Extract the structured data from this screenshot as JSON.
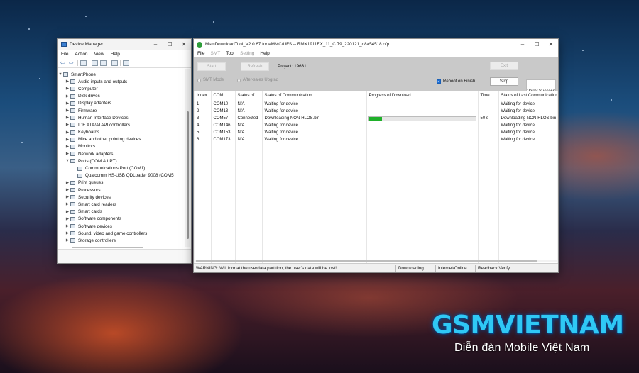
{
  "device_manager": {
    "title": "Device Manager",
    "menu": [
      "File",
      "Action",
      "View",
      "Help"
    ],
    "root": "SmartPhone",
    "categories": [
      {
        "label": "Audio inputs and outputs",
        "icon": "speaker-icon"
      },
      {
        "label": "Computer",
        "icon": "computer-icon"
      },
      {
        "label": "Disk drives",
        "icon": "disk-icon"
      },
      {
        "label": "Display adapters",
        "icon": "monitor-icon"
      },
      {
        "label": "Firmware",
        "icon": "chip-icon"
      },
      {
        "label": "Human Interface Devices",
        "icon": "hid-icon"
      },
      {
        "label": "IDE ATA/ATAPI controllers",
        "icon": "ide-icon"
      },
      {
        "label": "Keyboards",
        "icon": "keyboard-icon"
      },
      {
        "label": "Mice and other pointing devices",
        "icon": "mouse-icon"
      },
      {
        "label": "Monitors",
        "icon": "monitor-icon"
      },
      {
        "label": "Network adapters",
        "icon": "network-icon"
      },
      {
        "label": "Ports (COM & LPT)",
        "icon": "port-icon",
        "expanded": true,
        "children": [
          "Communications Port (COM1)",
          "Qualcomm HS-USB QDLoader 9008 (COM5"
        ]
      },
      {
        "label": "Print queues",
        "icon": "printer-icon"
      },
      {
        "label": "Processors",
        "icon": "cpu-icon"
      },
      {
        "label": "Security devices",
        "icon": "security-icon"
      },
      {
        "label": "Smart card readers",
        "icon": "card-reader-icon"
      },
      {
        "label": "Smart cards",
        "icon": "smart-card-icon"
      },
      {
        "label": "Software components",
        "icon": "component-icon"
      },
      {
        "label": "Software devices",
        "icon": "software-icon"
      },
      {
        "label": "Sound, video and game controllers",
        "icon": "sound-icon"
      },
      {
        "label": "Storage controllers",
        "icon": "storage-icon"
      }
    ]
  },
  "msm": {
    "title": "MsmDownloadTool_V2.0.67 for eMMC/UFS -- RMX1911EX_11_C.79_220121_d8a54518.ofp",
    "menu": [
      {
        "label": "File",
        "enabled": true
      },
      {
        "label": "SMT",
        "enabled": false
      },
      {
        "label": "Tool",
        "enabled": true
      },
      {
        "label": "Setting",
        "enabled": false
      },
      {
        "label": "Help",
        "enabled": true
      }
    ],
    "buttons": {
      "start": "Start",
      "refresh": "Refresh",
      "exit": "Exit",
      "stop": "Stop",
      "verify": "Verify Success"
    },
    "project": "Project: 19631",
    "smt_mode": "SMT Mode",
    "after_sales": "After-sales Upgrad",
    "reboot_on_finish": "Reboot on Finish",
    "columns": [
      "Index",
      "COM",
      "Status of ...",
      "Status of Communication",
      "Progress of Download",
      "Time",
      "Status of Last Communication"
    ],
    "rows": [
      {
        "index": "1",
        "com": "COM10",
        "status": "N/A",
        "comm": "Waiting for device",
        "progress": null,
        "time": "",
        "last": "Waiting for device"
      },
      {
        "index": "2",
        "com": "COM13",
        "status": "N/A",
        "comm": "Waiting for device",
        "progress": null,
        "time": "",
        "last": "Waiting for device"
      },
      {
        "index": "3",
        "com": "COM57",
        "status": "Connected",
        "comm": "Downloading NON-HLOS.bin",
        "progress": 0.12,
        "time": "50 s",
        "last": "Downloading NON-HLOS.bin"
      },
      {
        "index": "4",
        "com": "COM146",
        "status": "N/A",
        "comm": "Waiting for device",
        "progress": null,
        "time": "",
        "last": "Waiting for device"
      },
      {
        "index": "5",
        "com": "COM153",
        "status": "N/A",
        "comm": "Waiting for device",
        "progress": null,
        "time": "",
        "last": "Waiting for device"
      },
      {
        "index": "6",
        "com": "COM173",
        "status": "N/A",
        "comm": "Waiting for device",
        "progress": null,
        "time": "",
        "last": "Waiting for device"
      }
    ],
    "status_bar": {
      "warning": "WARNING: Will format the userdata partition, the user's data will be lost!",
      "state": "Downloading...",
      "network": "Internet/Online",
      "mode": "Readback Verify"
    }
  },
  "watermark": {
    "brand": "GSMVIETNAM",
    "tagline": "Diễn đàn Mobile Việt Nam"
  },
  "colors": {
    "progress": "#1fb02a",
    "brand": "#2fc8f5",
    "checkbox": "#1e6fd6"
  }
}
